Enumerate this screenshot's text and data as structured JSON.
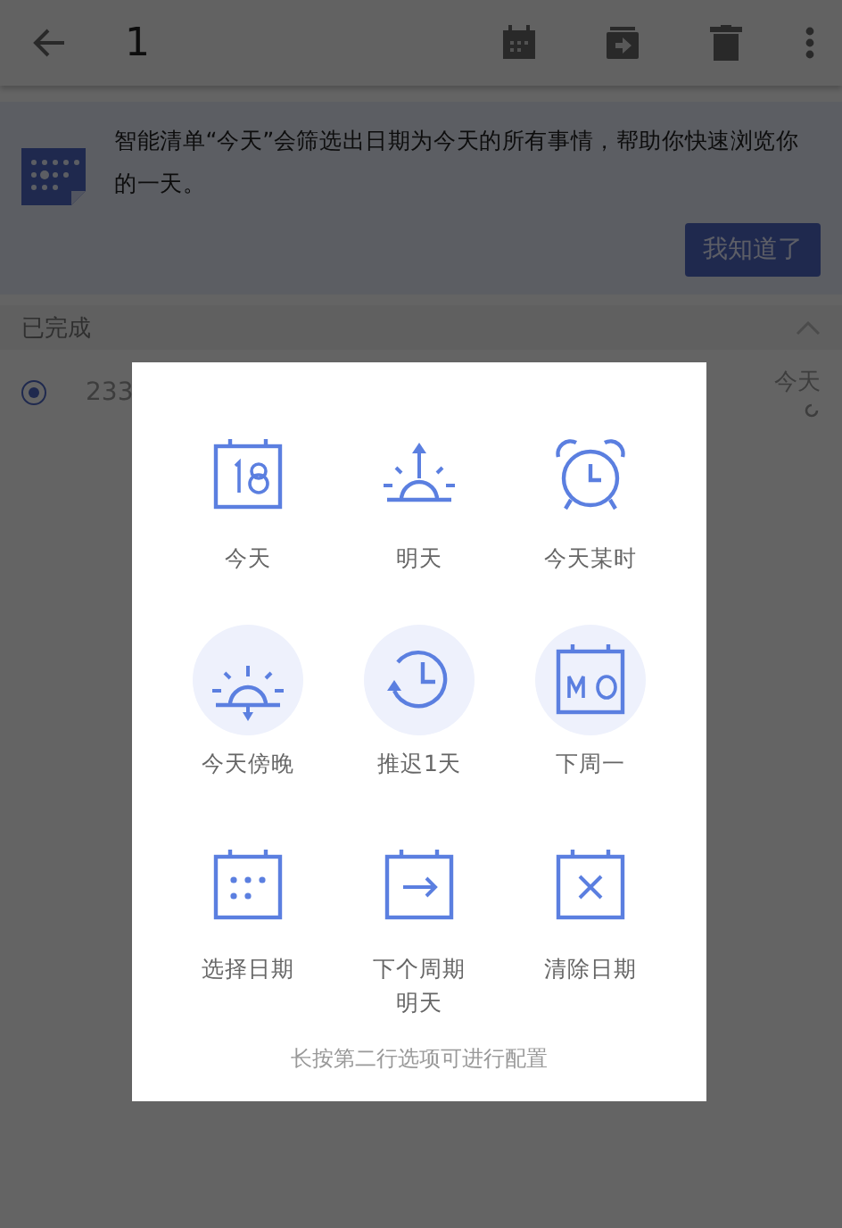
{
  "toolbar": {
    "title": "1"
  },
  "banner": {
    "text": "智能清单“今天”会筛选出日期为今天的所有事情，帮助你快速浏览你的一天。",
    "button": "我知道了"
  },
  "section": {
    "title": "已完成",
    "expanded": true
  },
  "tasks": [
    {
      "title": "233",
      "date": "今天",
      "checked": true
    }
  ],
  "dialog": {
    "options": [
      {
        "label": "今天",
        "highlighted": false
      },
      {
        "label": "明天",
        "highlighted": false
      },
      {
        "label": "今天某时",
        "highlighted": false
      },
      {
        "label": "今天傍晚",
        "highlighted": true
      },
      {
        "label": "推迟1天",
        "highlighted": true
      },
      {
        "label": "下周一",
        "highlighted": true
      },
      {
        "label": "选择日期",
        "highlighted": false
      },
      {
        "label": "下个周期",
        "sublabel": "明天",
        "highlighted": false
      },
      {
        "label": "清除日期",
        "highlighted": false
      }
    ],
    "hint": "长按第二行选项可进行配置"
  }
}
